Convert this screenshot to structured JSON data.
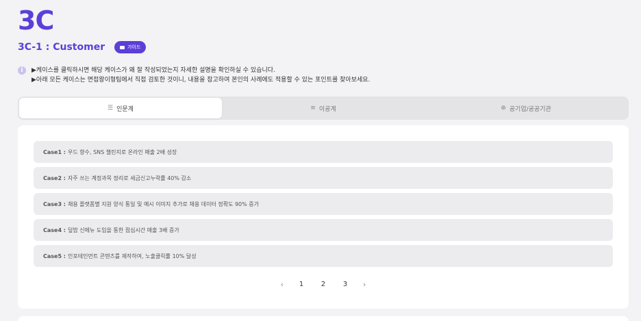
{
  "header": {
    "title": "3C",
    "section_title": "3C-1 : Customer",
    "guide_label": "가이드"
  },
  "notice": {
    "icon": "info-icon",
    "line1": "▶케이스를 클릭하시면 해당 케이스가 왜 잘 작성되었는지 자세한 설명을 확인하실 수 있습니다.",
    "line2": "▶아래 모든 케이스는 면접왕이형팀에서 직접 검토한 것이니, 내용을 참고하여 본인의 사례에도 적용할 수 있는 포인트를 찾아보세요."
  },
  "tabs": [
    {
      "label": "인문계",
      "icon": "list-icon",
      "active": true
    },
    {
      "label": "이공계",
      "icon": "layers-icon",
      "active": false
    },
    {
      "label": "공기업/공공기관",
      "icon": "globe-icon",
      "active": false
    }
  ],
  "cases": [
    {
      "no": "Case1 :",
      "text": "우드 향수, SNS 챌린지로 온라인 매출 2배 성장"
    },
    {
      "no": "Case2 :",
      "text": "자주 쓰는 계정과목 정리로 세금신고누락률 40% 감소"
    },
    {
      "no": "Case3 :",
      "text": "채용 플랫폼별 지원 양식 통일 및 예시 이미지 추가로 채용 데이터 정확도 90% 증가"
    },
    {
      "no": "Case4 :",
      "text": "덮밥 신메뉴 도입을 통한 점심시간 매출 3배 증가"
    },
    {
      "no": "Case5 :",
      "text": "인포테인먼트 콘텐츠를 제작하여, 노출클릭률 10% 달성"
    }
  ],
  "pagination": {
    "prev": "‹",
    "pages": [
      "1",
      "2",
      "3"
    ],
    "next": "›"
  },
  "colors": {
    "accent": "#5b3fd9",
    "background": "#f3f3f5",
    "case_bg": "#ececee"
  }
}
